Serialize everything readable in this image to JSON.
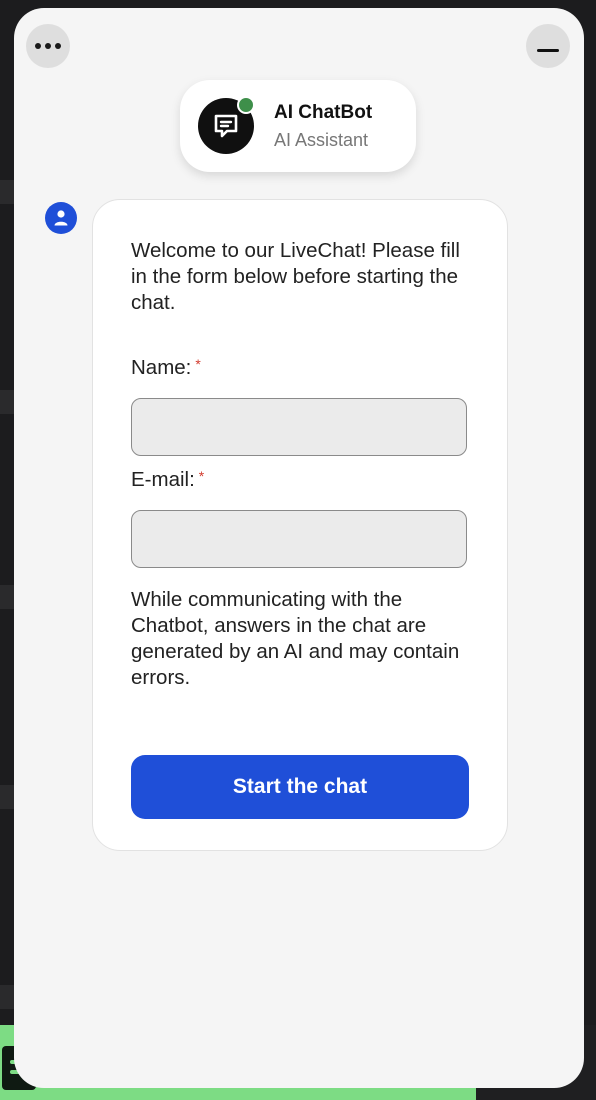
{
  "header": {
    "bot_name": "AI ChatBot",
    "bot_role": "AI Assistant",
    "status": "online"
  },
  "form": {
    "welcome_text": "Welcome to our LiveChat! Please fill in the form below before starting the chat.",
    "name_label": "Name:",
    "name_value": "",
    "email_label": "E-mail:",
    "email_value": "",
    "required_marker": "*",
    "disclaimer": "While communicating with the Chatbot, answers in the chat are generated by an AI and may contain errors.",
    "start_button": "Start the chat"
  },
  "colors": {
    "accent": "#1f4fd8",
    "online": "#3e8f4a",
    "required": "#d23b2e",
    "taskbar": "#7ddc84"
  },
  "icons": {
    "menu": "more-dots-icon",
    "minimize": "minimize-icon",
    "bot": "chat-bubble-icon",
    "user": "user-icon"
  }
}
